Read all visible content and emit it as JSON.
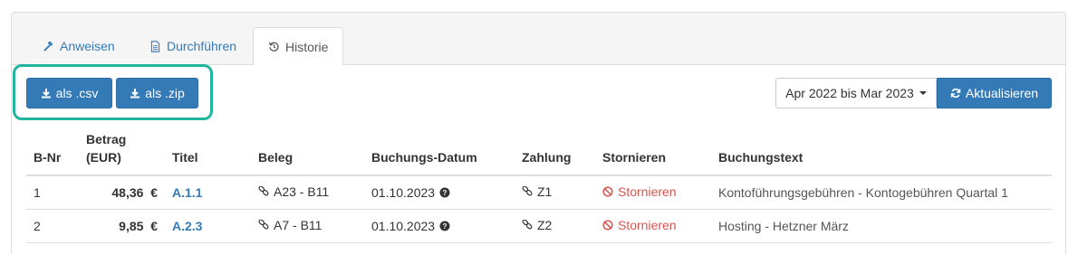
{
  "tabs": [
    {
      "label": "Anweisen",
      "icon": "gavel-icon"
    },
    {
      "label": "Durchführen",
      "icon": "file-text-icon"
    },
    {
      "label": "Historie",
      "icon": "history-icon",
      "active": true
    }
  ],
  "toolbar": {
    "export_csv": "als .csv",
    "export_zip": "als .zip",
    "date_range": "Apr 2022 bis Mar 2023",
    "refresh": "Aktualisieren"
  },
  "table": {
    "headers": {
      "nr": "B-Nr",
      "betrag_line1": "Betrag",
      "betrag_line2": "(EUR)",
      "titel": "Titel",
      "beleg": "Beleg",
      "datum": "Buchungs-Datum",
      "zahlung": "Zahlung",
      "stornieren": "Stornieren",
      "text": "Buchungstext"
    },
    "rows": [
      {
        "nr": "1",
        "betrag": "48,36",
        "currency": "€",
        "titel": "A.1.1",
        "beleg": "A23 - B11",
        "datum": "01.10.2023",
        "zahlung": "Z1",
        "storno": "Stornieren",
        "text": "Kontoführungsgebühren - Kontogebühren Quartal 1"
      },
      {
        "nr": "2",
        "betrag": "9,85",
        "currency": "€",
        "titel": "A.2.3",
        "beleg": "A7 - B11",
        "datum": "01.10.2023",
        "zahlung": "Z2",
        "storno": "Stornieren",
        "text": "Hosting - Hetzner März"
      }
    ]
  },
  "colors": {
    "primary": "#337ab7",
    "danger": "#d9534f",
    "highlight": "#21b49e"
  }
}
